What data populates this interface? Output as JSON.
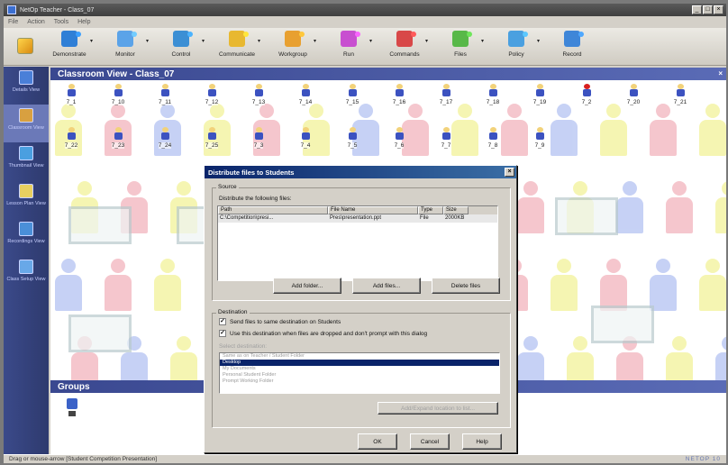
{
  "window": {
    "title": "NetOp Teacher - Class_07",
    "minimize": "_",
    "maximize": "□",
    "close": "×"
  },
  "menu": [
    "File",
    "Action",
    "Tools",
    "Help"
  ],
  "toolbar": {
    "buttons": [
      {
        "label": "Demonstrate",
        "icon": "demonstrate-icon",
        "color": "#2f7fd6"
      },
      {
        "label": "Monitor",
        "icon": "monitor-icon",
        "color": "#5ba3e8"
      },
      {
        "label": "Control",
        "icon": "control-icon",
        "color": "#3c8fd4"
      },
      {
        "label": "Communicate",
        "icon": "communicate-icon",
        "color": "#e8b830"
      },
      {
        "label": "Workgroup",
        "icon": "workgroup-icon",
        "color": "#e8a030"
      },
      {
        "label": "Run",
        "icon": "run-icon",
        "color": "#c84fd0"
      },
      {
        "label": "Commands",
        "icon": "commands-icon",
        "color": "#d84848"
      },
      {
        "label": "Files",
        "icon": "files-icon",
        "color": "#58b848"
      },
      {
        "label": "Policy",
        "icon": "policy-icon",
        "color": "#4aa0e0"
      },
      {
        "label": "Record",
        "icon": "record-icon",
        "color": "#3f86d8"
      }
    ]
  },
  "sidebar": {
    "items": [
      {
        "label": "Details View",
        "icon": "details-view-icon",
        "color": "#4a7fd8"
      },
      {
        "label": "Classroom View",
        "icon": "classroom-view-icon",
        "color": "#d8a040"
      },
      {
        "label": "Thumbnail View",
        "icon": "thumbnail-view-icon",
        "color": "#4a9fe0"
      },
      {
        "label": "Lesson Plan View",
        "icon": "lesson-plan-view-icon",
        "color": "#e8d060"
      },
      {
        "label": "Recordings View",
        "icon": "recordings-view-icon",
        "color": "#4a8fd8"
      },
      {
        "label": "Class Setup View",
        "icon": "class-setup-view-icon",
        "color": "#68a8e8"
      }
    ]
  },
  "classroom": {
    "title": "Classroom View - Class_07",
    "students_row1": [
      "7_1",
      "7_10",
      "7_11",
      "7_12",
      "7_13",
      "7_14",
      "7_15",
      "7_16",
      "7_17",
      "7_18",
      "7_19",
      "7_2",
      "7_20",
      "7_21"
    ],
    "students_row2": [
      "7_22",
      "7_23",
      "7_24",
      "7_25",
      "7_3",
      "7_4",
      "7_5",
      "7_6",
      "7_7",
      "7_8",
      "7_9"
    ]
  },
  "groups": {
    "title": "Groups"
  },
  "statusbar": {
    "text": "Drag or mouse-arrow [Student Competition Presentation]",
    "right": "NETOP 10"
  },
  "dialog": {
    "title": "Distribute files to Students",
    "source_label": "Source",
    "files_label": "Distribute the following files:",
    "columns": [
      "Path",
      "File Name",
      "Type",
      "Size"
    ],
    "rows": [
      [
        "C:\\Competition\\presi...",
        "Pres\\presentation.ppt",
        "File",
        "2000KB"
      ]
    ],
    "buttons": {
      "add_folder": "Add folder...",
      "add_files": "Add files...",
      "delete_files": "Delete files",
      "copy": "Add/Expand location to list...",
      "ok": "OK",
      "cancel": "Cancel",
      "help": "Help"
    },
    "destination_label": "Destination",
    "check1": "Send files to same destination on Students",
    "check2": "Use this destination when files are dropped and don't prompt with this dialog",
    "dest_folder_label": "Select destination:",
    "dest_options": [
      "Same as on Teacher / Student Folder",
      "Desktop",
      "My Documents",
      "Personal Student Folder",
      "Prompt Working Folder"
    ],
    "dest_selected": 1
  }
}
